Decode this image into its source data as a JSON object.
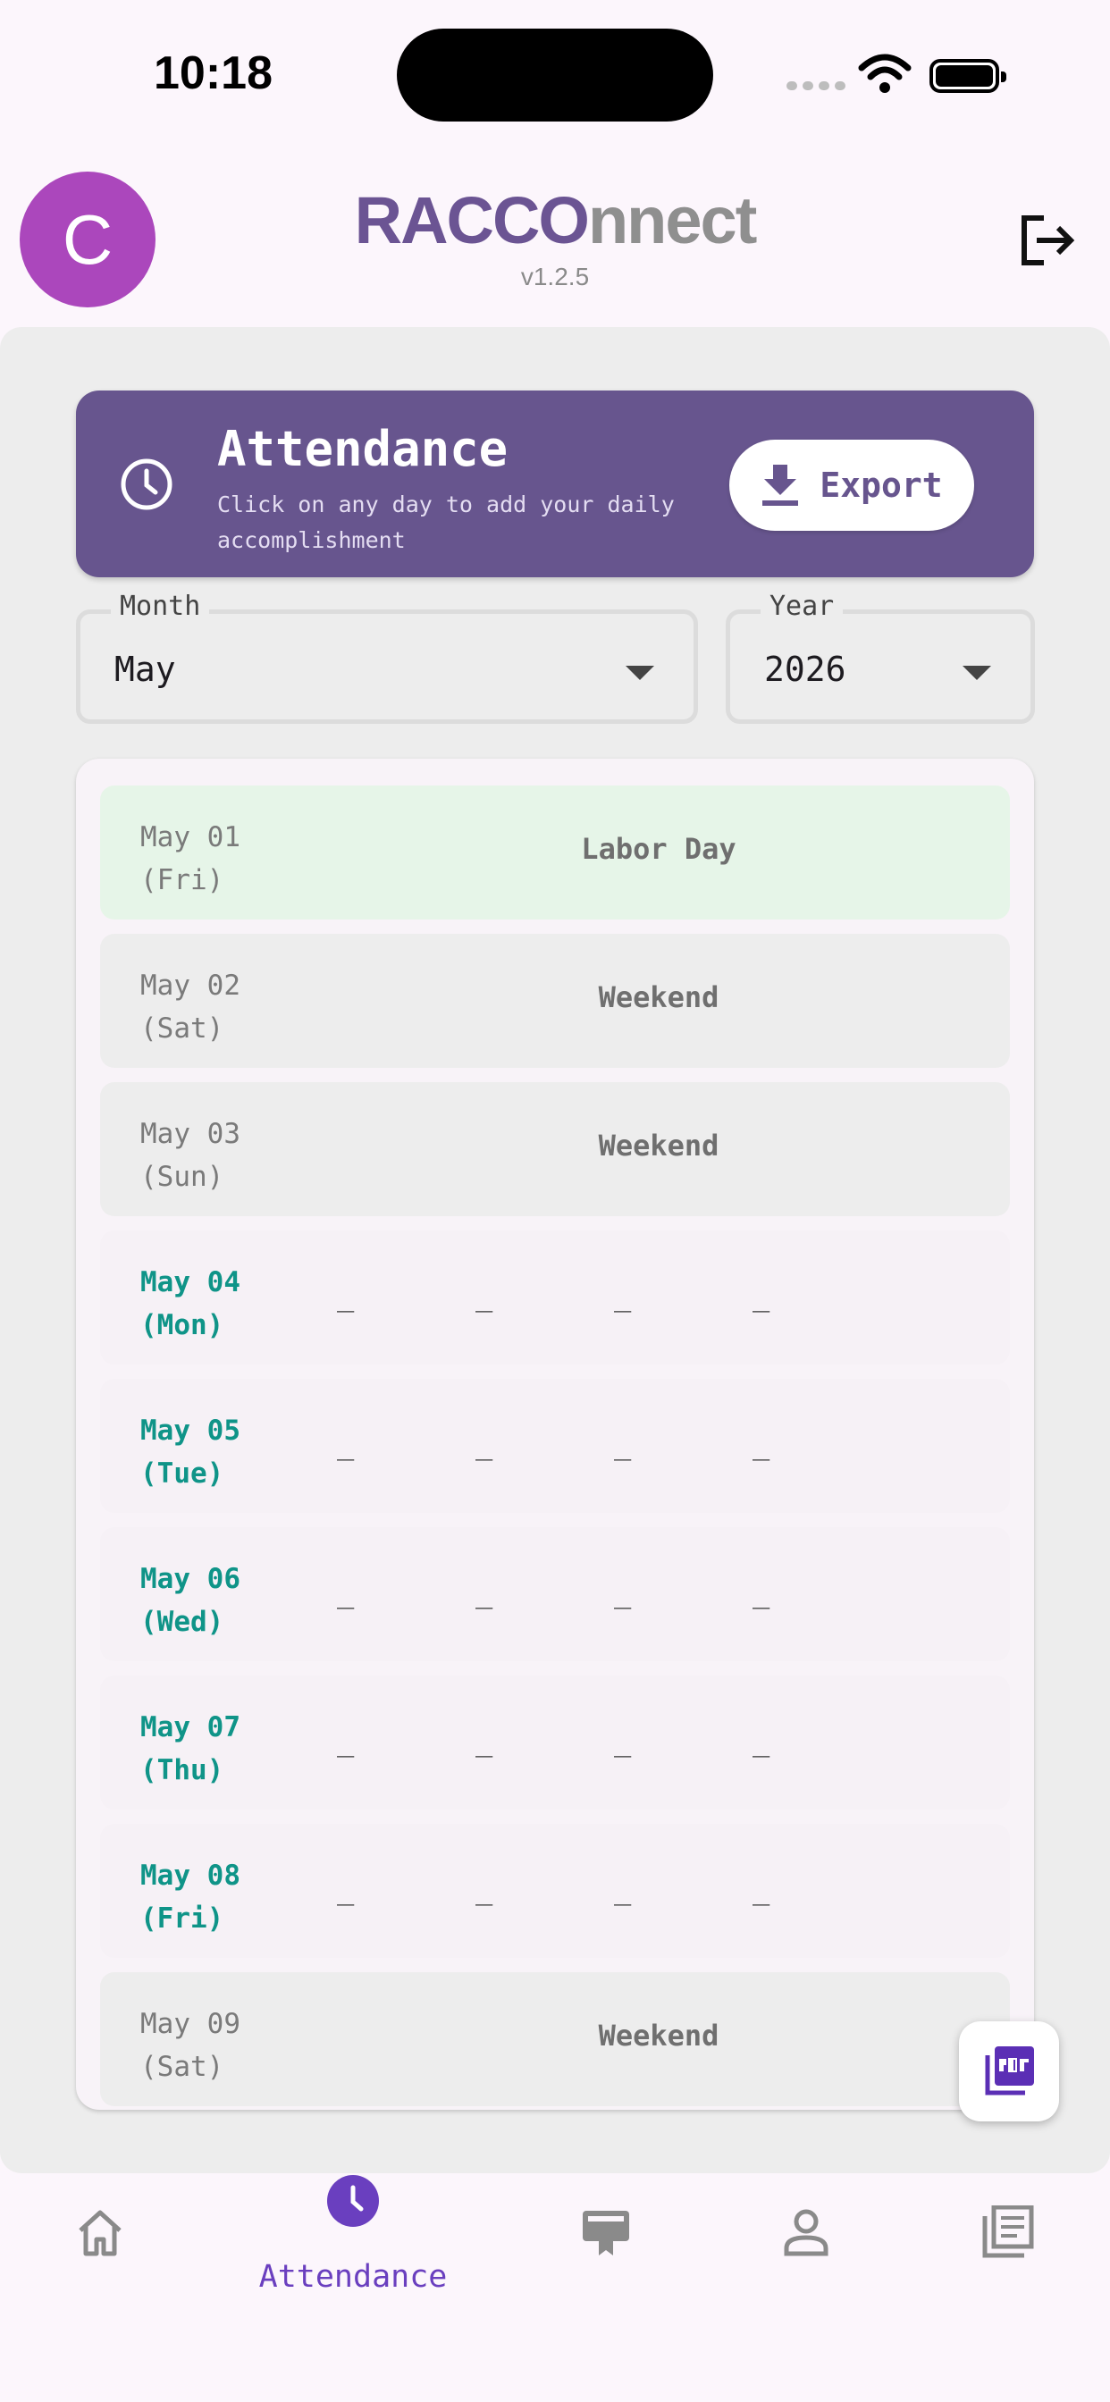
{
  "status_bar": {
    "time": "10:18"
  },
  "header": {
    "avatar_letter": "C",
    "brand_part1": "RACCO",
    "brand_part2": "nnect",
    "version": "v1.2.5",
    "icons": {
      "logout": "logout-icon"
    }
  },
  "banner": {
    "title": "Attendance",
    "subtitle": "Click on any day to add your daily accomplishment",
    "export_label": "Export",
    "icons": {
      "clock": "clock-icon",
      "export": "download-icon"
    },
    "color": "#67558E"
  },
  "filters": {
    "month": {
      "label": "Month",
      "value": "May"
    },
    "year": {
      "label": "Year",
      "value": "2026"
    }
  },
  "days": [
    {
      "date": "May 01",
      "weekday": "(Fri)",
      "type": "holiday",
      "label": "Labor Day"
    },
    {
      "date": "May 02",
      "weekday": "(Sat)",
      "type": "weekend",
      "label": "Weekend"
    },
    {
      "date": "May 03",
      "weekday": "(Sun)",
      "type": "weekend",
      "label": "Weekend"
    },
    {
      "date": "May 04",
      "weekday": "(Mon)",
      "type": "work",
      "cols": [
        "_",
        "_",
        "_",
        "_"
      ]
    },
    {
      "date": "May 05",
      "weekday": "(Tue)",
      "type": "work",
      "cols": [
        "_",
        "_",
        "_",
        "_"
      ]
    },
    {
      "date": "May 06",
      "weekday": "(Wed)",
      "type": "work",
      "cols": [
        "_",
        "_",
        "_",
        "_"
      ]
    },
    {
      "date": "May 07",
      "weekday": "(Thu)",
      "type": "work",
      "cols": [
        "_",
        "_",
        "_",
        "_"
      ]
    },
    {
      "date": "May 08",
      "weekday": "(Fri)",
      "type": "work",
      "cols": [
        "_",
        "_",
        "_",
        "_"
      ]
    },
    {
      "date": "May 09",
      "weekday": "(Sat)",
      "type": "weekend",
      "label": "Weekend"
    }
  ],
  "fab": {
    "icon": "pdf-icon"
  },
  "nav": {
    "items": [
      "home-icon",
      "clock-icon",
      "desk-icon",
      "person-icon",
      "articles-icon"
    ],
    "active_label": "Attendance",
    "accent": "#6A3FBF"
  }
}
